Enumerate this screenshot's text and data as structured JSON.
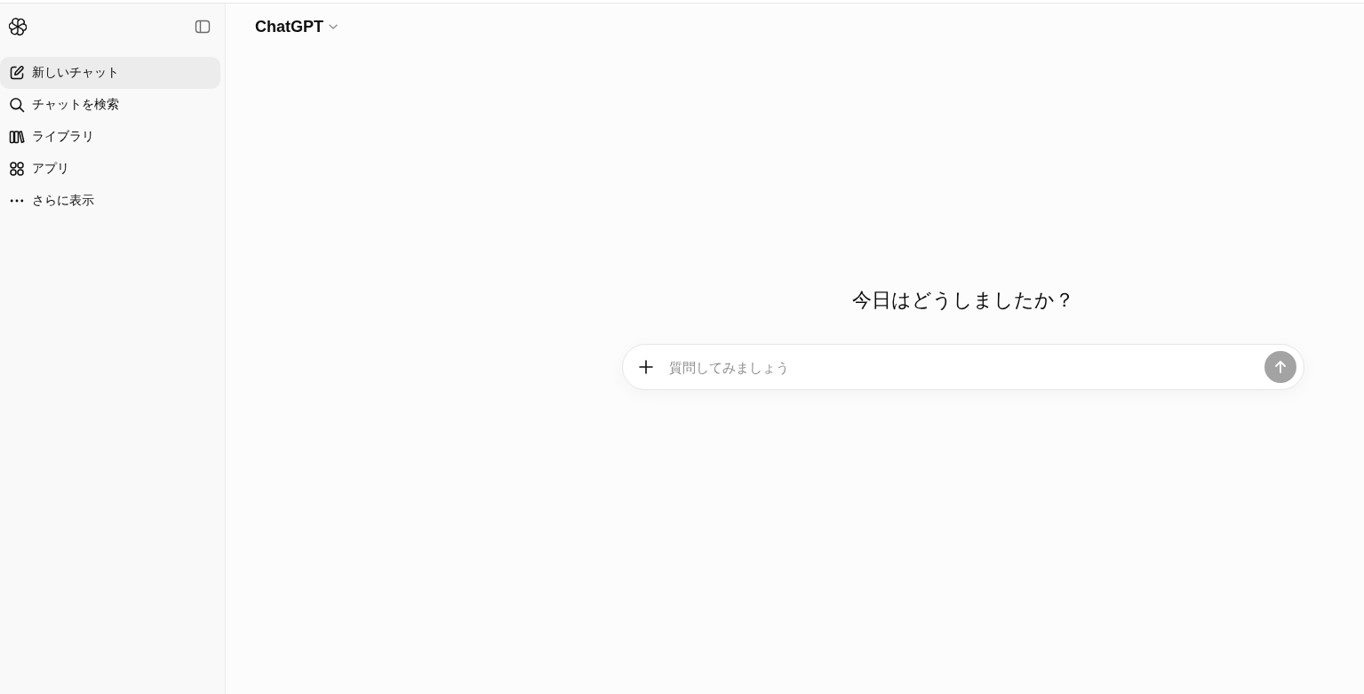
{
  "sidebar": {
    "items": [
      {
        "kind": "new-chat",
        "label": "新しいチャット",
        "selected": true
      },
      {
        "kind": "search",
        "label": "チャットを検索",
        "selected": false
      },
      {
        "kind": "library",
        "label": "ライブラリ",
        "selected": false
      },
      {
        "kind": "apps",
        "label": "アプリ",
        "selected": false
      },
      {
        "kind": "more",
        "label": "さらに表示",
        "selected": false
      }
    ]
  },
  "header": {
    "title": "ChatGPT"
  },
  "main": {
    "heading": "今日はどうしましたか？"
  },
  "composer": {
    "placeholder": "質問してみましょう"
  }
}
